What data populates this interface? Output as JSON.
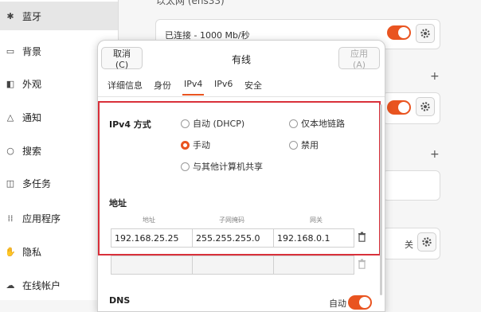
{
  "sidebar": {
    "items": [
      {
        "label": "蓝牙",
        "icon": "bluetooth-icon",
        "glyph": "✱",
        "active": true
      },
      {
        "label": "背景",
        "icon": "background-icon",
        "glyph": "▭",
        "active": false
      },
      {
        "label": "外观",
        "icon": "appearance-icon",
        "glyph": "◧",
        "active": false
      },
      {
        "label": "通知",
        "icon": "bell-icon",
        "glyph": "△",
        "active": false
      },
      {
        "label": "搜索",
        "icon": "search-icon",
        "glyph": "○",
        "active": false
      },
      {
        "label": "多任务",
        "icon": "multitask-icon",
        "glyph": "◫",
        "active": false
      },
      {
        "label": "应用程序",
        "icon": "apps-grid-icon",
        "glyph": "⁞⁞",
        "active": false
      },
      {
        "label": "隐私",
        "icon": "hand-icon",
        "glyph": "✋",
        "active": false
      },
      {
        "label": "在线帐户",
        "icon": "cloud-icon",
        "glyph": "☁",
        "active": false
      }
    ]
  },
  "background": {
    "section_title": "以太网 (ens33)",
    "connected_text": "已连接 - 1000 Mb/秒",
    "off_text": "关"
  },
  "dialog": {
    "cancel_label": "取消(C)",
    "title": "有线",
    "apply_label": "应用(A)",
    "tabs": [
      "详细信息",
      "身份",
      "IPv4",
      "IPv6",
      "安全"
    ],
    "active_tab": "IPv4",
    "method_label": "IPv4 方式",
    "methods": {
      "auto": "自动 (DHCP)",
      "link_local": "仅本地链路",
      "manual": "手动",
      "disabled": "禁用",
      "shared": "与其他计算机共享"
    },
    "selected_method": "手动",
    "address_section": "地址",
    "columns": [
      "地址",
      "子网掩码",
      "网关"
    ],
    "rows": [
      {
        "address": "192.168.25.25",
        "netmask": "255.255.255.0",
        "gateway": "192.168.0.1"
      },
      {
        "address": "",
        "netmask": "",
        "gateway": ""
      }
    ],
    "dns_label": "DNS",
    "dns_auto_label": "自动"
  },
  "colors": {
    "accent": "#e95420",
    "highlight": "#d9303a"
  }
}
